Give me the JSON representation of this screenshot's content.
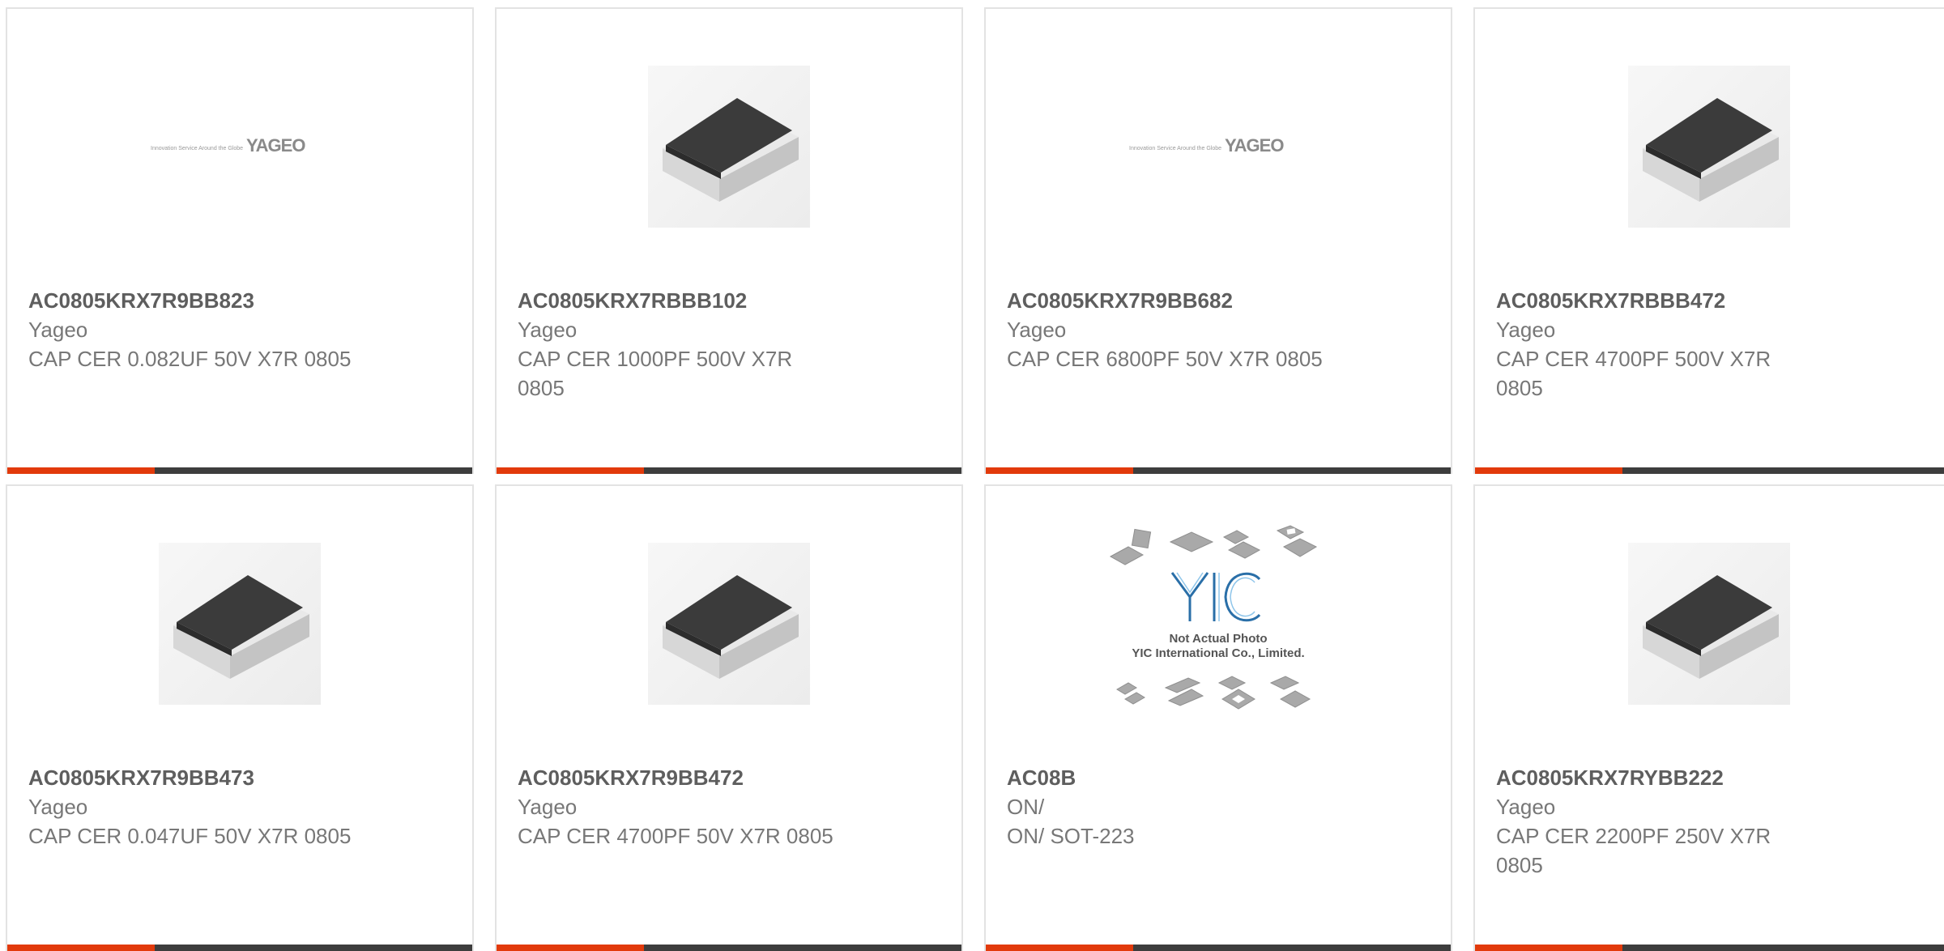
{
  "colors": {
    "accent": "#e23a0b",
    "bar_dark": "#3d3d3d",
    "border": "#e3e3e3",
    "text_bold": "#5e5e5e",
    "text": "#777777"
  },
  "products": [
    {
      "part_number": "AC0805KRX7R9BB823",
      "manufacturer": "Yageo",
      "description": "CAP CER 0.082UF 50V X7R 0805",
      "image": "yageo-logo",
      "logo_text": "YAGEO",
      "logo_tagline": "Innovation Service Around the Globe"
    },
    {
      "part_number": "AC0805KRX7RBBB102",
      "manufacturer": "Yageo",
      "description": "CAP CER 1000PF 500V X7R 0805",
      "image": "smd-capacitor"
    },
    {
      "part_number": "AC0805KRX7R9BB682",
      "manufacturer": "Yageo",
      "description": "CAP CER 6800PF 50V X7R 0805",
      "image": "yageo-logo",
      "logo_text": "YAGEO",
      "logo_tagline": "Innovation Service Around the Globe"
    },
    {
      "part_number": "AC0805KRX7RBBB472",
      "manufacturer": "Yageo",
      "description": "CAP CER 4700PF 500V X7R 0805",
      "image": "smd-capacitor"
    },
    {
      "part_number": "AC0805KRX7R9BB473",
      "manufacturer": "Yageo",
      "description": "CAP CER 0.047UF 50V X7R 0805",
      "image": "smd-capacitor"
    },
    {
      "part_number": "AC0805KRX7R9BB472",
      "manufacturer": "Yageo",
      "description": "CAP CER 4700PF 50V X7R 0805",
      "image": "smd-capacitor"
    },
    {
      "part_number": "AC08B",
      "manufacturer": "ON/",
      "description": "ON/ SOT-223",
      "image": "yic-placeholder",
      "placeholder_logo": "YIC",
      "placeholder_line1": "Not Actual Photo",
      "placeholder_line2": "YIC International Co., Limited."
    },
    {
      "part_number": "AC0805KRX7RYBB222",
      "manufacturer": "Yageo",
      "description": "CAP CER 2200PF 250V X7R 0805",
      "image": "smd-capacitor"
    }
  ]
}
